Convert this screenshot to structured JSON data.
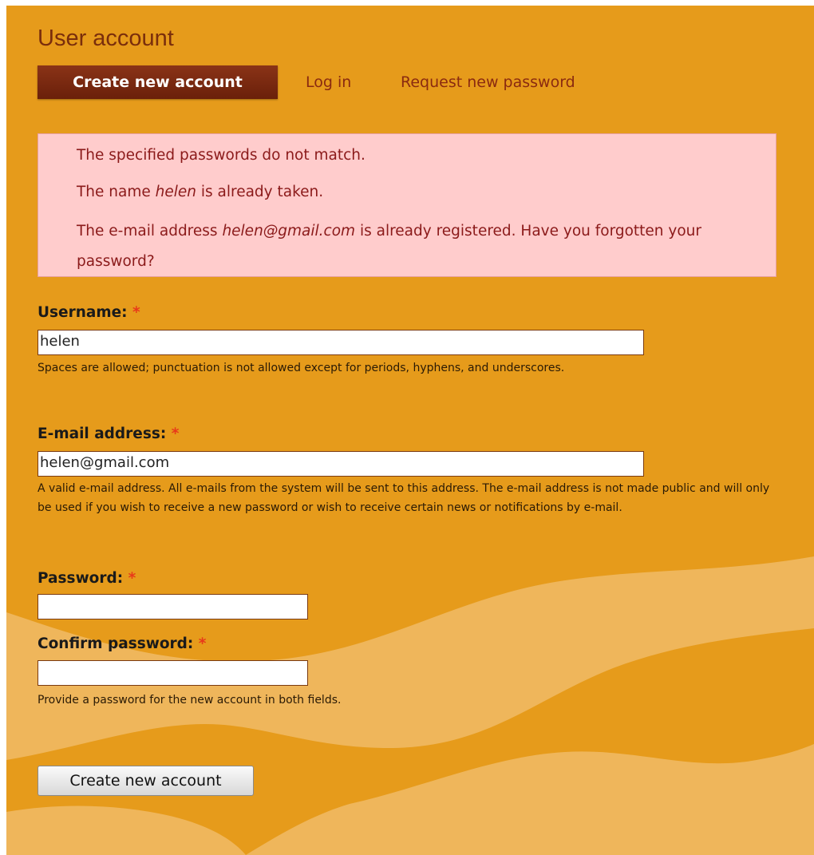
{
  "page": {
    "title": "User account"
  },
  "tabs": {
    "create": "Create new account",
    "login": "Log in",
    "request": "Request new password"
  },
  "messages": {
    "passwords_mismatch": "The specified passwords do not match.",
    "name_taken": {
      "before": "The name ",
      "name": "helen",
      "after": " is already taken."
    },
    "email_registered": {
      "before": "The e-mail address ",
      "email": "helen@gmail.com",
      "after": " is already registered. Have you forgotten your password?"
    }
  },
  "form": {
    "username": {
      "label": "Username:",
      "required_marker": "*",
      "value": "helen",
      "description": "Spaces are allowed; punctuation is not allowed except for periods, hyphens, and underscores."
    },
    "email": {
      "label": "E-mail address:",
      "required_marker": "*",
      "value": "helen@gmail.com",
      "description": "A valid e-mail address. All e-mails from the system will be sent to this address. The e-mail address is not made public and will only be used if you wish to receive a new password or wish to receive certain news or notifications by e-mail."
    },
    "password": {
      "label": "Password:",
      "required_marker": "*",
      "value": ""
    },
    "confirm_password": {
      "label": "Confirm password:",
      "required_marker": "*",
      "value": "",
      "description": "Provide a password for the new account in both fields."
    },
    "submit_label": "Create new account"
  },
  "colors": {
    "background": "#E69B1B",
    "swoosh": "#EFB65B",
    "tab_active": "#7A2710",
    "error_box": "#FFCCCC",
    "error_text": "#8B1A1A",
    "required_marker": "#E8391A"
  }
}
